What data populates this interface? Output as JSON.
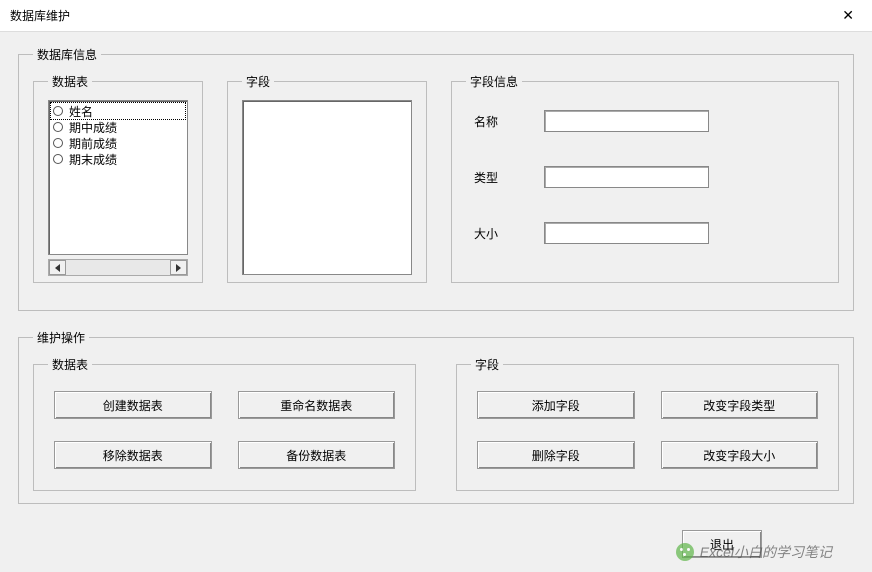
{
  "window": {
    "title": "数据库维护"
  },
  "dbInfo": {
    "legend": "数据库信息",
    "tables": {
      "legend": "数据表",
      "items": [
        "姓名",
        "期中成绩",
        "期前成绩",
        "期末成绩"
      ]
    },
    "fields": {
      "legend": "字段"
    },
    "fieldInfo": {
      "legend": "字段信息",
      "name": {
        "label": "名称",
        "value": ""
      },
      "type": {
        "label": "类型",
        "value": ""
      },
      "size": {
        "label": "大小",
        "value": ""
      }
    }
  },
  "ops": {
    "legend": "维护操作",
    "tables": {
      "legend": "数据表",
      "create": "创建数据表",
      "rename": "重命名数据表",
      "remove": "移除数据表",
      "backup": "备份数据表"
    },
    "fields": {
      "legend": "字段",
      "add": "添加字段",
      "changeType": "改变字段类型",
      "delete": "删除字段",
      "changeSize": "改变字段大小"
    }
  },
  "bottom": {
    "exit": "退出"
  },
  "watermark": "Excel小白的学习笔记"
}
